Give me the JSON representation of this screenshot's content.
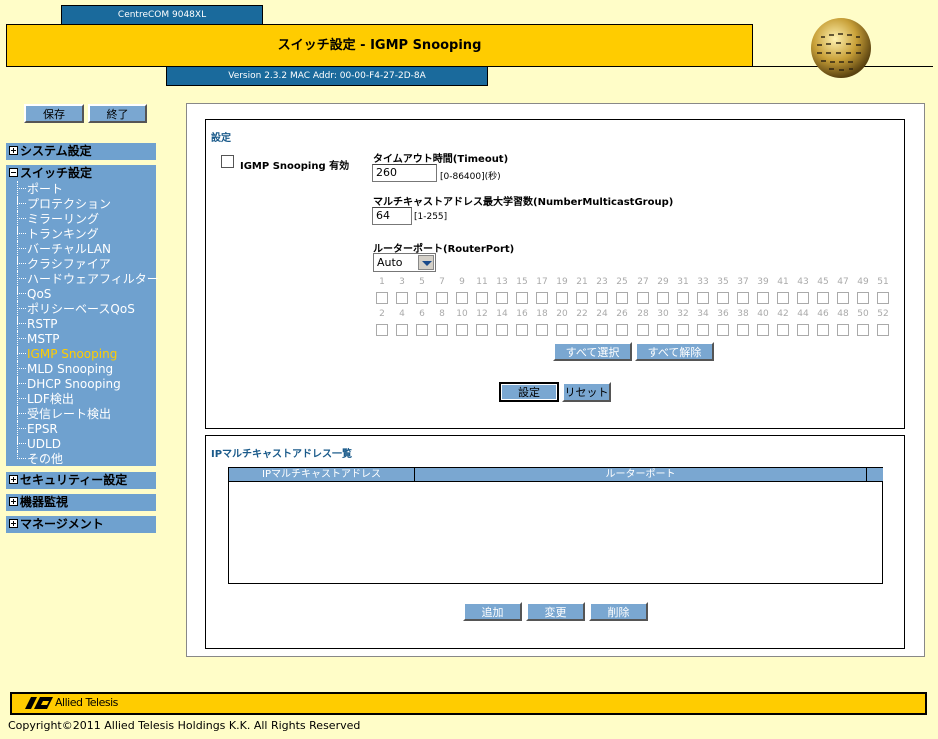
{
  "header": {
    "model": "CentreCOM 9048XL",
    "title": "スイッチ設定 - IGMP Snooping",
    "version": "Version 2.3.2 MAC Addr: 00-00-F4-27-2D-8A"
  },
  "toolbar": {
    "save_label": "保存",
    "exit_label": "終了"
  },
  "sidebar": {
    "system": "システム設定",
    "switch": "スイッチ設定",
    "items": [
      "ポート",
      "プロテクション",
      "ミラーリング",
      "トランキング",
      "バーチャルLAN",
      "クラシファイア",
      "ハードウェアフィルター",
      "QoS",
      "ポリシーベースQoS",
      "RSTP",
      "MSTP",
      "IGMP Snooping",
      "MLD Snooping",
      "DHCP Snooping",
      "LDF検出",
      "受信レート検出",
      "EPSR",
      "UDLD",
      "その他"
    ],
    "active_item": "IGMP Snooping",
    "security": "セキュリティー設定",
    "monitor": "機器監視",
    "management": "マネージメント"
  },
  "settings": {
    "heading": "設定",
    "enable_label": "IGMP Snooping 有効",
    "timeout_label": "タイムアウト時間(Timeout)",
    "timeout_value": "260",
    "timeout_hint": "[0-86400](秒)",
    "maxgroup_label": "マルチキャストアドレス最大学習数(NumberMulticastGroup)",
    "maxgroup_value": "64",
    "maxgroup_hint": "[1-255]",
    "routerport_label": "ルーターポート(RouterPort)",
    "routerport_value": "Auto",
    "ports_odd": [
      "1",
      "3",
      "5",
      "7",
      "9",
      "11",
      "13",
      "15",
      "17",
      "19",
      "21",
      "23",
      "25",
      "27",
      "29",
      "31",
      "33",
      "35",
      "37",
      "39",
      "41",
      "43",
      "45",
      "47",
      "49",
      "51"
    ],
    "ports_even": [
      "2",
      "4",
      "6",
      "8",
      "10",
      "12",
      "14",
      "16",
      "18",
      "20",
      "22",
      "24",
      "26",
      "28",
      "30",
      "32",
      "34",
      "36",
      "38",
      "40",
      "42",
      "44",
      "46",
      "48",
      "50",
      "52"
    ],
    "select_all": "すべて選択",
    "deselect_all": "すべて解除",
    "apply": "設定",
    "reset": "リセット"
  },
  "list": {
    "heading": "IPマルチキャストアドレス一覧",
    "col_address": "IPマルチキャストアドレス",
    "col_routerport": "ルーターポート",
    "add": "追加",
    "modify": "変更",
    "delete": "削除"
  },
  "footer": {
    "brand": "Allied Telesis",
    "copyright": "Copyright©2011 Allied Telesis Holdings K.K. All Rights Reserved"
  }
}
